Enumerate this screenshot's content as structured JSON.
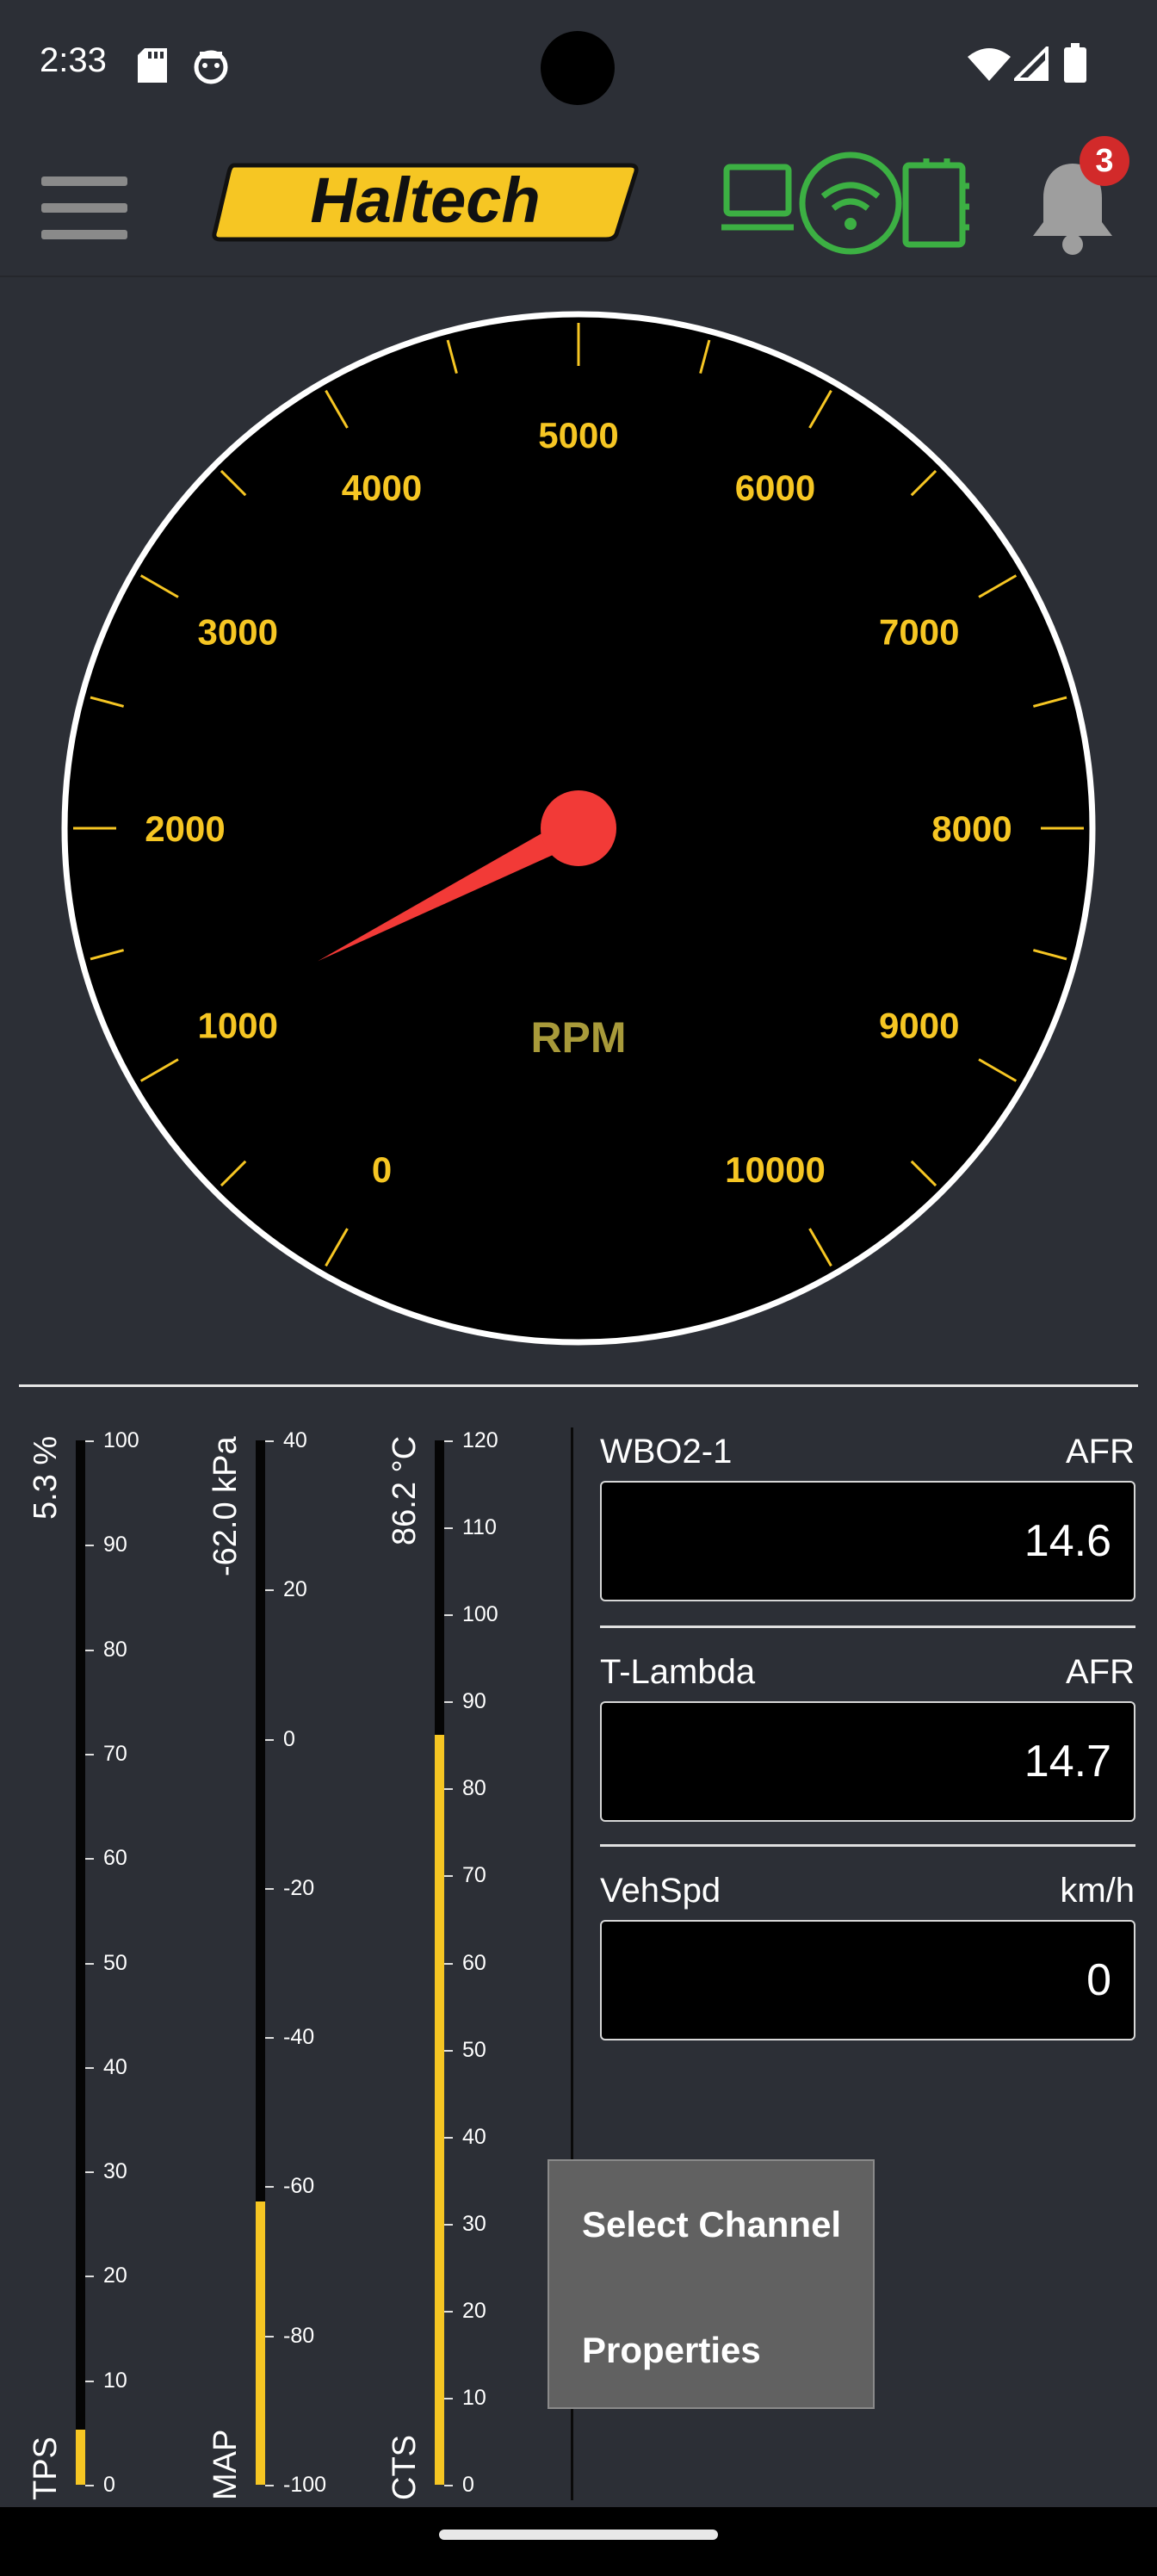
{
  "status_bar": {
    "time": "2:33"
  },
  "app_bar": {
    "brand": "Haltech",
    "notification_count": "3"
  },
  "rpm_gauge": {
    "label": "RPM",
    "min": 0,
    "max": 10000,
    "value": 1100,
    "tick_labels": [
      "0",
      "1000",
      "2000",
      "3000",
      "4000",
      "5000",
      "6000",
      "7000",
      "8000",
      "9000",
      "10000"
    ]
  },
  "bar_gauges": [
    {
      "name": "TPS",
      "reading": "5.3 %",
      "min": 0,
      "max": 100,
      "value": 5.3,
      "ticks": [
        "100",
        "90",
        "80",
        "70",
        "60",
        "50",
        "40",
        "30",
        "20",
        "10",
        "0"
      ]
    },
    {
      "name": "MAP",
      "reading": "-62.0 kPa",
      "min": -100,
      "max": 40,
      "value": -62.0,
      "ticks": [
        "40",
        "20",
        "0",
        "-20",
        "-40",
        "-60",
        "-80",
        "-100"
      ]
    },
    {
      "name": "CTS",
      "reading": "86.2 °C",
      "min": 0,
      "max": 120,
      "value": 86.2,
      "ticks": [
        "120",
        "110",
        "100",
        "90",
        "80",
        "70",
        "60",
        "50",
        "40",
        "30",
        "20",
        "10",
        "0"
      ]
    }
  ],
  "value_panels": [
    {
      "label": "WBO2-1",
      "unit": "AFR",
      "value": "14.6"
    },
    {
      "label": "T-Lambda",
      "unit": "AFR",
      "value": "14.7"
    },
    {
      "label": "VehSpd",
      "unit": "km/h",
      "value": "0"
    }
  ],
  "context_menu": {
    "items": [
      "Select Channel",
      "Properties"
    ]
  },
  "colors": {
    "background": "#2c2f36",
    "gauge_face": "#000000",
    "accent_yellow": "#f6c623",
    "needle_red": "#f23a37",
    "connection_green": "#3cb043",
    "rpm_label": "#a89a3a"
  }
}
